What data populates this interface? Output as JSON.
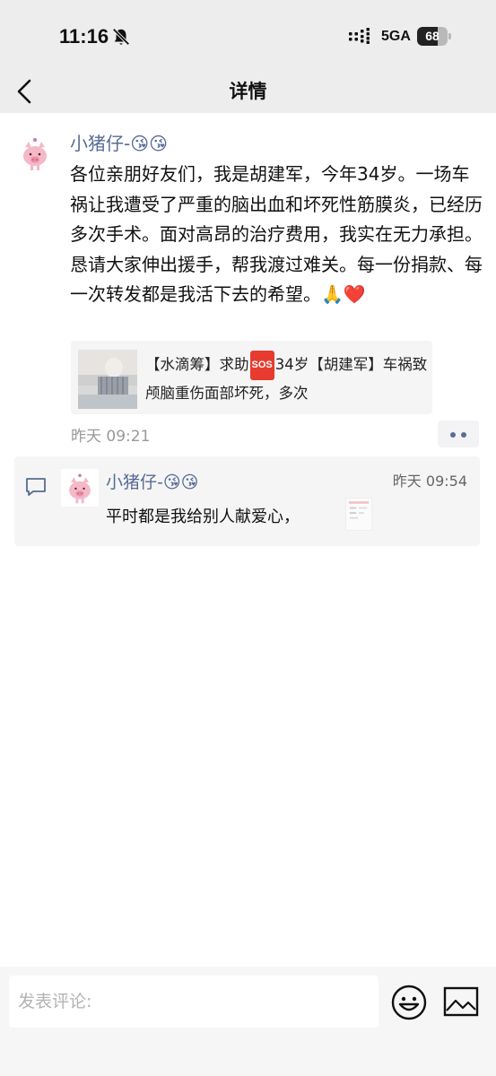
{
  "status_bar": {
    "time": "11:16",
    "network": "5GA",
    "battery_level": "68",
    "battery_fraction": 0.68
  },
  "nav": {
    "title": "详情"
  },
  "post": {
    "username": "小猪仔-😘😘",
    "text": "各位亲朋好友们，我是胡建军，今年34岁。一场车祸让我遭受了严重的脑出血和坏死性筋膜炎，已经历多次手术。面对高昂的治疗费用，我实在无力承担。恳请大家伸出援手，帮我渡过难关。每一份捐款、每一次转发都是我活下去的希望。🙏❤️",
    "link_card": {
      "title_part1": "【水滴筹】求助",
      "sos": "SOS",
      "title_part2": "34岁【胡建军】车祸致颅脑重伤面部坏死，多次"
    },
    "time": "昨天 09:21"
  },
  "comment": {
    "username": "小猪仔-😘😘",
    "time": "昨天 09:54",
    "text": "平时都是我给别人献爱心，"
  },
  "bottom_bar": {
    "placeholder": "发表评论:"
  },
  "colors": {
    "link_blue": "#576b95",
    "background_gray": "#ededed",
    "card_gray": "#f5f5f5"
  },
  "icons": [
    "bell-off-icon",
    "signal-icon",
    "back-icon",
    "more-icon",
    "comment-icon",
    "emoji-icon",
    "image-icon"
  ]
}
